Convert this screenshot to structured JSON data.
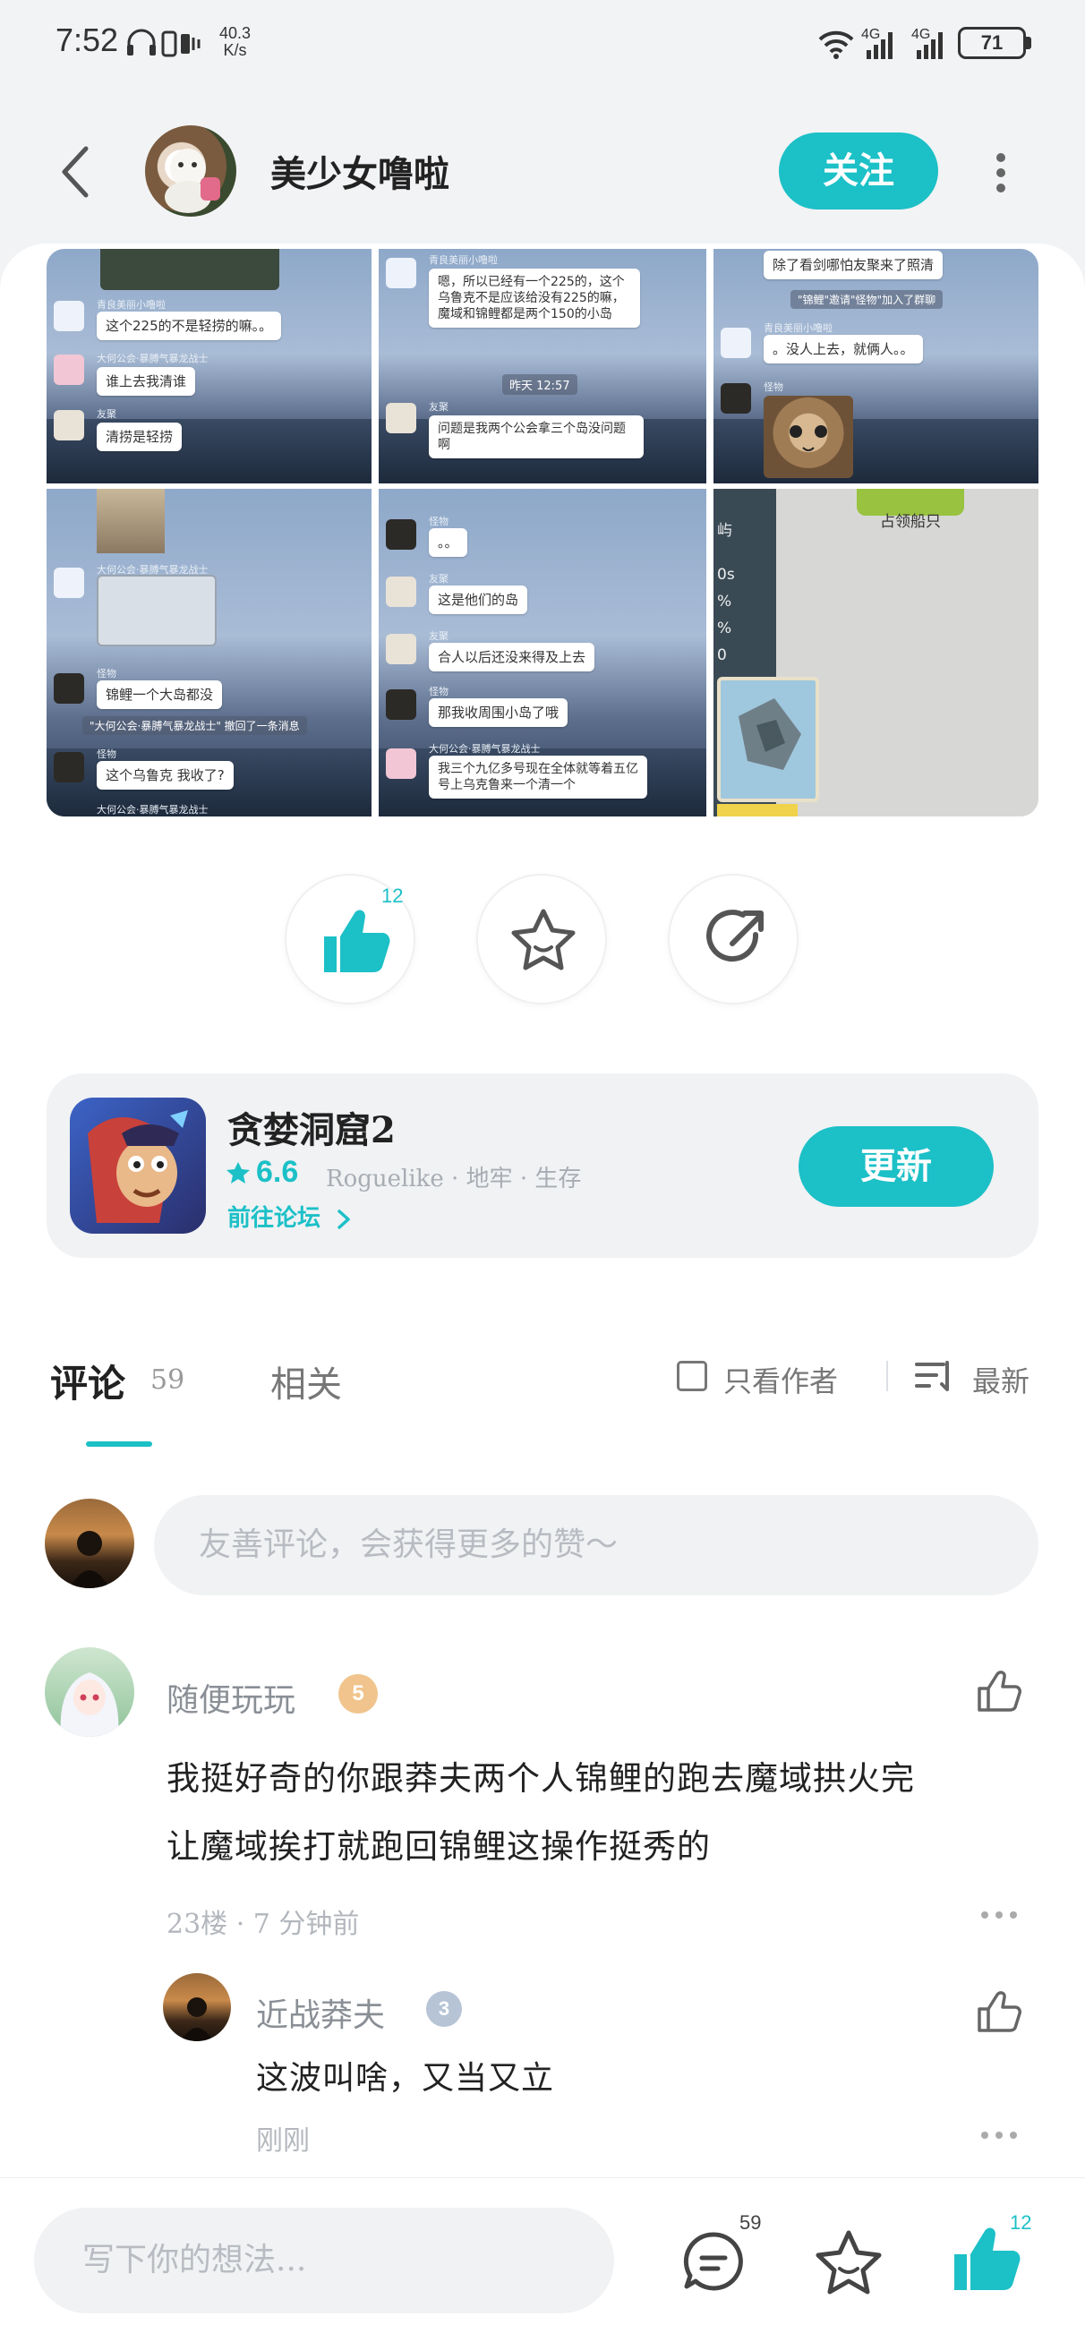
{
  "status_bar": {
    "time": "7:52",
    "net_speed_top": "40.3",
    "net_speed_bottom": "K/s",
    "network_label_1": "4G",
    "network_label_2": "4G",
    "battery": "71"
  },
  "header": {
    "username": "美少女噜啦",
    "follow_label": "关注"
  },
  "screenshots": {
    "cell1": {
      "sender1": "青良美丽小噜啦",
      "msg1": "这个225的不是轻捞的嘛。。",
      "sender2": "大何公会·暴膊气暴龙战士",
      "msg2": "谁上去我清谁",
      "sender3": "友聚",
      "msg3": "清捞是轻捞"
    },
    "cell2": {
      "sender1": "青良美丽小噜啦",
      "msg1": "嗯，所以已经有一个225的，这个乌鲁克不是应该给没有225的嘛，魔域和锦鲤都是两个150的小岛",
      "time": "昨天 12:57",
      "sender2": "友聚",
      "msg2": "问题是我两个公会拿三个岛没问题啊"
    },
    "cell3": {
      "msg1": "除了看剑哪怕友聚来了照清",
      "sys": "\"锦鲤\"邀请\"怪物\"加入了群聊",
      "sender1": "青良美丽小噜啦",
      "msg2": "。没人上去，就俩人。。",
      "sender2": "怪物"
    },
    "cell4": {
      "sender1": "大何公会·暴膊气暴龙战士",
      "sender2": "怪物",
      "msg1": "锦鲤一个大岛都没",
      "sys": "\"大何公会·暴膊气暴龙战士\" 撤回了一条消息",
      "sender3": "怪物",
      "msg2": "这个乌鲁克 我收了?",
      "sender4": "大何公会·暴膊气暴龙战士"
    },
    "cell5": {
      "sender1": "怪物",
      "msg1": "。。",
      "sender2": "友聚",
      "msg2": "这是他们的岛",
      "sender3": "友聚",
      "msg3": "合人以后还没来得及上去",
      "sender4": "怪物",
      "msg4": "那我收周围小岛了哦",
      "sender5": "大何公会·暴膊气暴龙战士",
      "msg5": "我三个九亿多号现在全体就等着五亿号上乌克鲁来一个清一个"
    },
    "cell6": {
      "title": "占领船只",
      "fragment1": "屿",
      "fragment2": "0s",
      "fragment3": "%",
      "fragment4": "%",
      "fragment5": "0"
    }
  },
  "actions": {
    "like_count": "12"
  },
  "game": {
    "name": "贪婪洞窟2",
    "rating": "6.6",
    "tags": "Roguelike · 地牢 · 生存",
    "forum_link": "前往论坛",
    "update_label": "更新"
  },
  "comments_section": {
    "tab_comments": "评论",
    "comments_count": "59",
    "tab_related": "相关",
    "only_author": "只看作者",
    "sort_label": "最新",
    "input_placeholder": "友善评论，会获得更多的赞～",
    "items": [
      {
        "username": "随便玩玩",
        "level": "5",
        "text_line1": "我挺好奇的你跟莽夫两个人锦鲤的跑去魔域拱火完",
        "text_line2": "让魔域挨打就跑回锦鲤这操作挺秀的",
        "meta": "23楼 · 7 分钟前"
      },
      {
        "username": "近战莽夫",
        "level": "3",
        "text": "这波叫啥，又当又立",
        "meta": "刚刚"
      }
    ]
  },
  "bottom_bar": {
    "placeholder": "写下你的想法...",
    "comment_count": "59",
    "like_count": "12"
  },
  "colors": {
    "accent": "#1cc0c7",
    "background": "#f2f3f5"
  }
}
